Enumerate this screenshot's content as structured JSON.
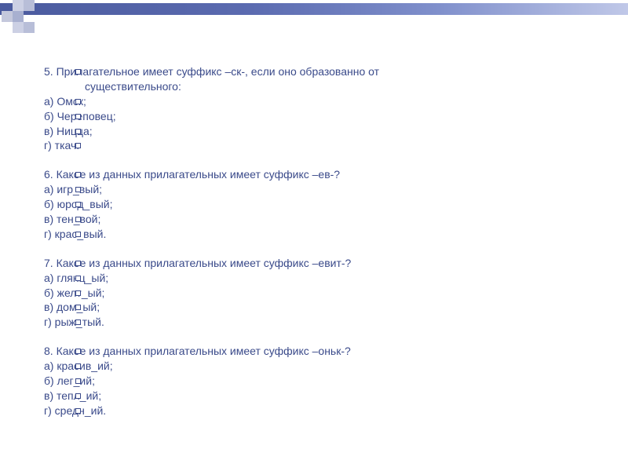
{
  "questions": [
    {
      "number": "5.",
      "text_line1": "Прилагательное имеет суффикс –ск-, если оно образованно от",
      "text_line2": "существительного:",
      "options": [
        {
          "letter": "а)",
          "text": "Омск;"
        },
        {
          "letter": "б)",
          "text": "Череповец;"
        },
        {
          "letter": "в)",
          "text": "Ницца;"
        },
        {
          "letter": "г)",
          "text": "ткач."
        }
      ]
    },
    {
      "number": "6.",
      "text_line1": "Какое из данных прилагательных имеет суффикс –ев-?",
      "options": [
        {
          "letter": "а)",
          "text": "игр_вый;"
        },
        {
          "letter": "б)",
          "text": "юрод_вый;"
        },
        {
          "letter": "в)",
          "text": "тен_вой;"
        },
        {
          "letter": "г)",
          "text": " крас_вый."
        }
      ]
    },
    {
      "number": "7.",
      "text_line1": "Какое из данных прилагательных имеет суффикс –евит-?",
      "options": [
        {
          "letter": "а)",
          "text": "глянц_ый;"
        },
        {
          "letter": "б)",
          "text": "желт_ый;"
        },
        {
          "letter": "в)",
          "text": "дом_ый;"
        },
        {
          "letter": "г)",
          "text": "рыж_тый."
        }
      ]
    },
    {
      "number": "8.",
      "text_line1": "Какое из данных прилагательных имеет суффикс –оньк-?",
      "options": [
        {
          "letter": "а)",
          "text": "красив_ий;"
        },
        {
          "letter": "б)",
          "text": "лег_ий;"
        },
        {
          "letter": "в)",
          "text": "тепл_ий;"
        },
        {
          "letter": "г)",
          "text": "средн_ий."
        }
      ]
    }
  ]
}
